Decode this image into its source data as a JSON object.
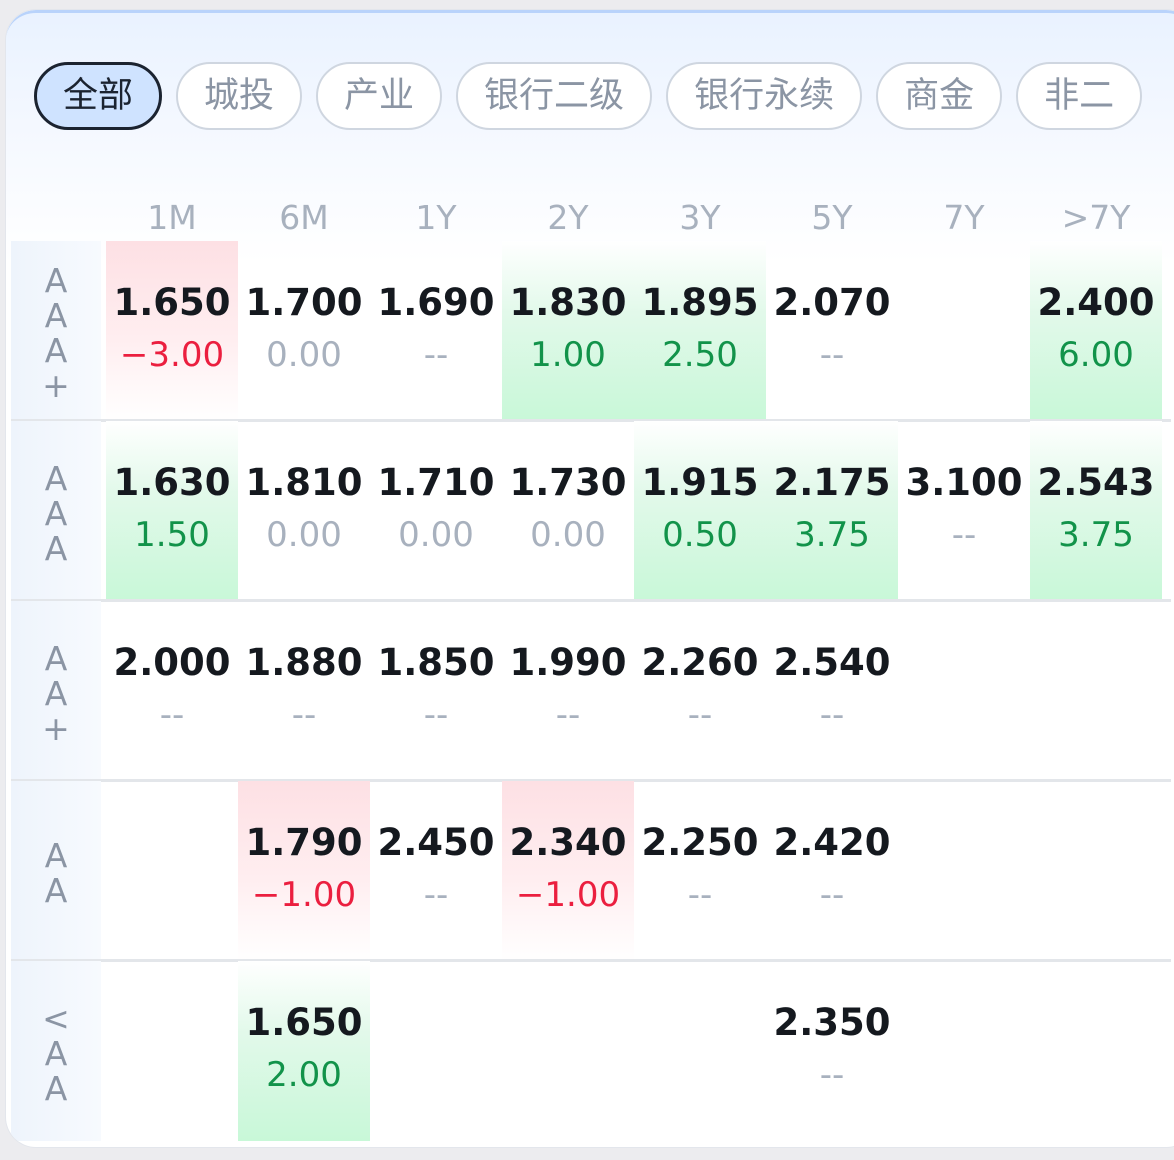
{
  "tabs": [
    "全部",
    "城投",
    "产业",
    "银行二级",
    "银行永续",
    "商金",
    "非二"
  ],
  "active_tab": 0,
  "columns": [
    "1M",
    "6M",
    "1Y",
    "2Y",
    "3Y",
    "5Y",
    "7Y",
    ">7Y"
  ],
  "rows": [
    {
      "label": "AAA+",
      "cells": [
        {
          "value": "1.650",
          "change": "−3.00",
          "trend": "down"
        },
        {
          "value": "1.700",
          "change": "0.00",
          "trend": "flat"
        },
        {
          "value": "1.690",
          "change": "--",
          "trend": "flat"
        },
        {
          "value": "1.830",
          "change": "1.00",
          "trend": "up"
        },
        {
          "value": "1.895",
          "change": "2.50",
          "trend": "up"
        },
        {
          "value": "2.070",
          "change": "--",
          "trend": "flat"
        },
        null,
        {
          "value": "2.400",
          "change": "6.00",
          "trend": "up"
        }
      ]
    },
    {
      "label": "AAA",
      "cells": [
        {
          "value": "1.630",
          "change": "1.50",
          "trend": "up"
        },
        {
          "value": "1.810",
          "change": "0.00",
          "trend": "flat"
        },
        {
          "value": "1.710",
          "change": "0.00",
          "trend": "flat"
        },
        {
          "value": "1.730",
          "change": "0.00",
          "trend": "flat"
        },
        {
          "value": "1.915",
          "change": "0.50",
          "trend": "up"
        },
        {
          "value": "2.175",
          "change": "3.75",
          "trend": "up"
        },
        {
          "value": "3.100",
          "change": "--",
          "trend": "flat"
        },
        {
          "value": "2.543",
          "change": "3.75",
          "trend": "up"
        }
      ]
    },
    {
      "label": "AA+",
      "cells": [
        {
          "value": "2.000",
          "change": "--",
          "trend": "flat"
        },
        {
          "value": "1.880",
          "change": "--",
          "trend": "flat"
        },
        {
          "value": "1.850",
          "change": "--",
          "trend": "flat"
        },
        {
          "value": "1.990",
          "change": "--",
          "trend": "flat"
        },
        {
          "value": "2.260",
          "change": "--",
          "trend": "flat"
        },
        {
          "value": "2.540",
          "change": "--",
          "trend": "flat"
        },
        null,
        null
      ]
    },
    {
      "label": "AA",
      "cells": [
        null,
        {
          "value": "1.790",
          "change": "−1.00",
          "trend": "down"
        },
        {
          "value": "2.450",
          "change": "--",
          "trend": "flat"
        },
        {
          "value": "2.340",
          "change": "−1.00",
          "trend": "down"
        },
        {
          "value": "2.250",
          "change": "--",
          "trend": "flat"
        },
        {
          "value": "2.420",
          "change": "--",
          "trend": "flat"
        },
        null,
        null
      ]
    },
    {
      "label": "<AA",
      "cells": [
        null,
        {
          "value": "1.650",
          "change": "2.00",
          "trend": "up"
        },
        null,
        null,
        null,
        {
          "value": "2.350",
          "change": "--",
          "trend": "flat"
        },
        null,
        null
      ]
    }
  ],
  "colors": {
    "up": "#12934a",
    "down": "#eb1f3f",
    "flat": "#a8b1be",
    "value": "#15191f"
  }
}
